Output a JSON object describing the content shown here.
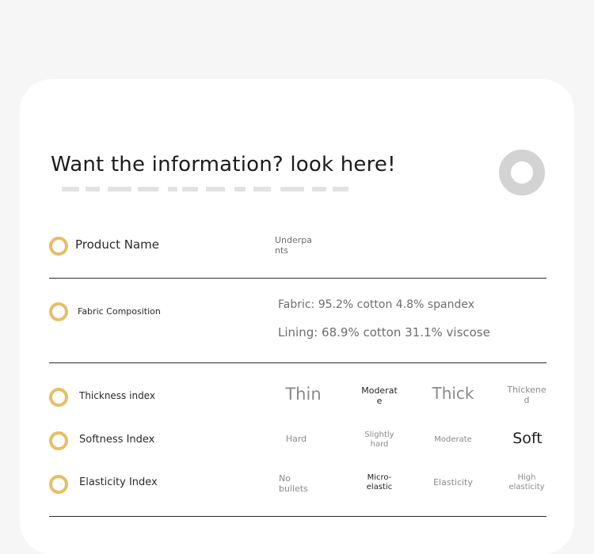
{
  "header": {
    "title": "Want the information? look here!"
  },
  "product": {
    "label": "Product Name",
    "value_line1": "Underpa",
    "value_line2": "nts"
  },
  "fabric": {
    "label": "Fabric Composition",
    "fabric": "Fabric: 95.2% cotton 4.8% spandex",
    "lining": "Lining: 68.9% cotton 31.1% viscose"
  },
  "thickness": {
    "label": "Thickness index",
    "options": [
      {
        "line1": "Thin",
        "line2": ""
      },
      {
        "line1": "Moderat",
        "line2": "e"
      },
      {
        "line1": "Thick",
        "line2": ""
      },
      {
        "line1": "Thickene",
        "line2": "d"
      }
    ]
  },
  "softness": {
    "label": "Softness Index",
    "options": [
      {
        "line1": "Hard",
        "line2": ""
      },
      {
        "line1": "Slightly",
        "line2": "hard"
      },
      {
        "line1": "Moderate",
        "line2": ""
      },
      {
        "line1": "Soft",
        "line2": ""
      }
    ]
  },
  "elasticity": {
    "label": "Elasticity Index",
    "options": [
      {
        "line1": "No",
        "line2": "bullets"
      },
      {
        "line1": "Micro-",
        "line2": "elastic"
      },
      {
        "line1": "Elasticity",
        "line2": ""
      },
      {
        "line1": "High",
        "line2": "elasticity"
      }
    ]
  },
  "colors": {
    "accent": "#e7be66",
    "divider": "#2b2b2b",
    "donut": "#d3d3d3"
  }
}
